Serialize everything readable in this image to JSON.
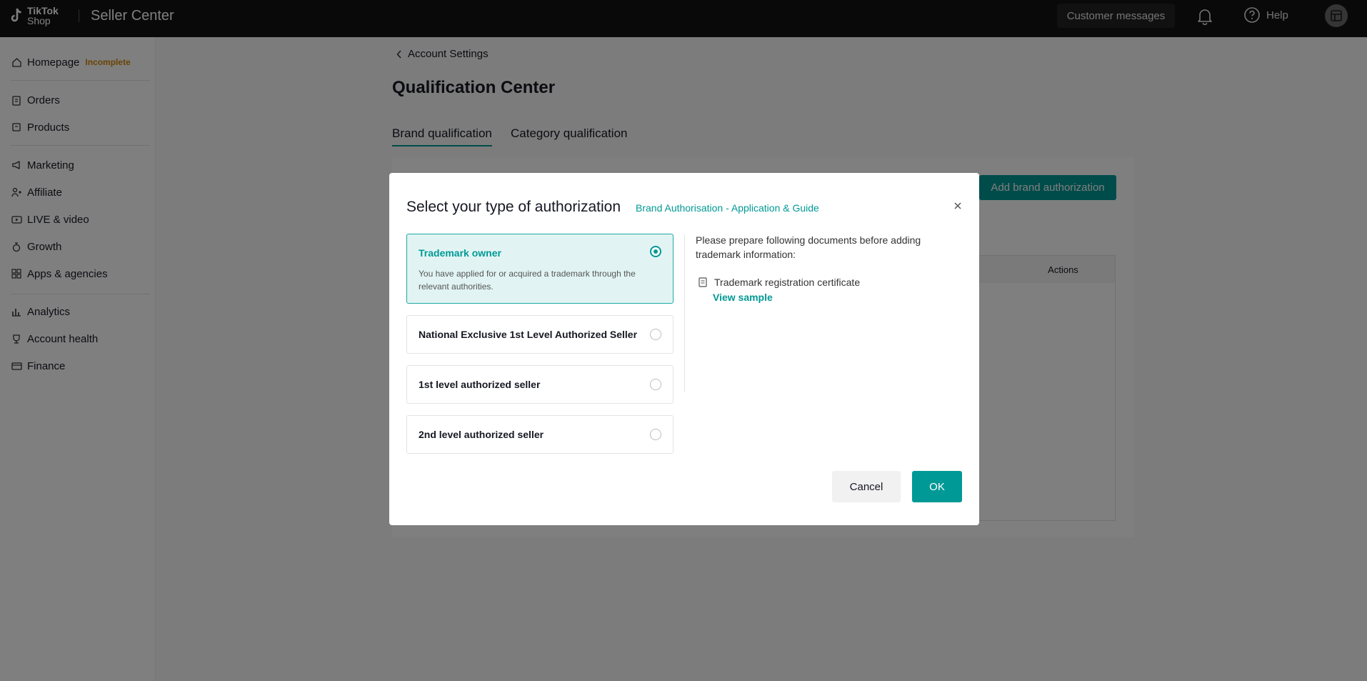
{
  "topbar": {
    "logo_line1": "TikTok",
    "logo_line2": "Shop",
    "title": "Seller Center",
    "customer_messages": "Customer messages",
    "help": "Help"
  },
  "sidebar": {
    "homepage": {
      "label": "Homepage",
      "badge": "Incomplete"
    },
    "items": [
      {
        "label": "Orders",
        "icon": "clipboard-icon"
      },
      {
        "label": "Products",
        "icon": "box-icon"
      },
      {
        "label": "Marketing",
        "icon": "megaphone-icon"
      },
      {
        "label": "Affiliate",
        "icon": "people-icon"
      },
      {
        "label": "LIVE & video",
        "icon": "video-icon"
      },
      {
        "label": "Growth",
        "icon": "growth-icon"
      },
      {
        "label": "Apps & agencies",
        "icon": "apps-icon"
      },
      {
        "label": "Analytics",
        "icon": "chart-icon"
      },
      {
        "label": "Account health",
        "icon": "trophy-icon"
      },
      {
        "label": "Finance",
        "icon": "wallet-icon"
      }
    ]
  },
  "page": {
    "breadcrumb": "Account Settings",
    "title": "Qualification Center",
    "tabs": [
      "Brand qualification",
      "Category qualification"
    ],
    "add_button": "Add brand authorization",
    "table_header_actions": "Actions"
  },
  "modal": {
    "title": "Select your type of authorization",
    "guide_link": "Brand Authorisation - Application & Guide",
    "options": [
      {
        "label": "Trademark owner",
        "description": "You have applied for or acquired a trademark through the relevant authorities.",
        "selected": true
      },
      {
        "label": "National Exclusive 1st Level Authorized Seller",
        "selected": false
      },
      {
        "label": "1st level authorized seller",
        "selected": false
      },
      {
        "label": "2nd level authorized seller",
        "selected": false
      }
    ],
    "prepare_text": "Please prepare following documents before adding trademark information:",
    "document": "Trademark registration certificate",
    "view_sample": "View sample",
    "cancel": "Cancel",
    "ok": "OK"
  },
  "colors": {
    "accent": "#009995",
    "topbar": "#121212",
    "badge": "#d48806"
  }
}
